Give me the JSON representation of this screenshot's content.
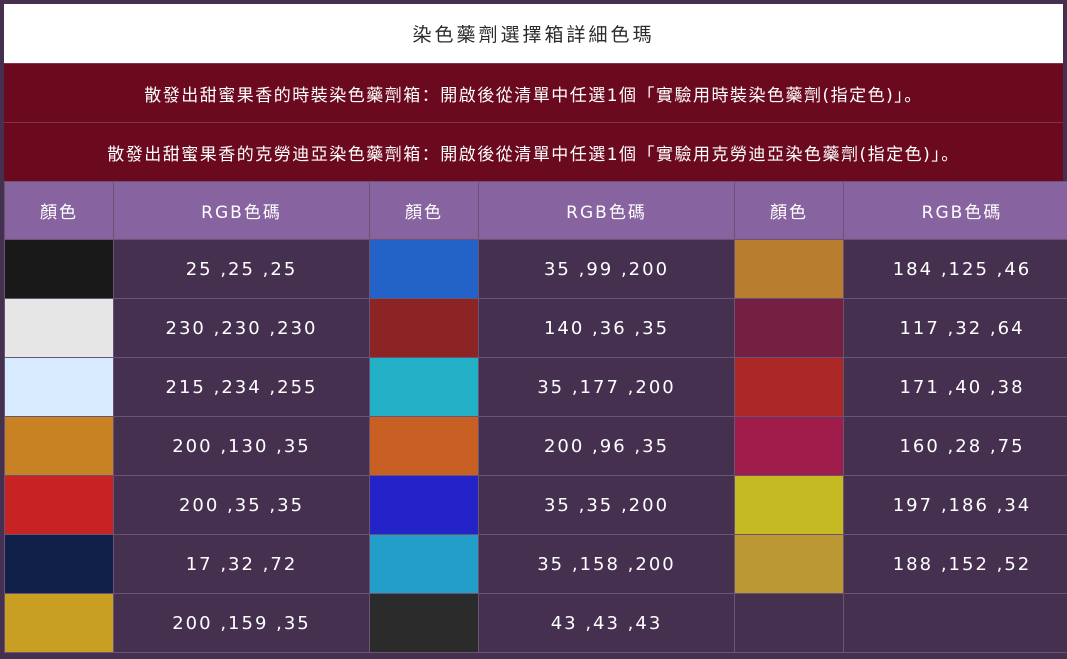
{
  "title": "染色藥劑選擇箱詳細色瑪",
  "descriptions": [
    "散發出甜蜜果香的時裝染色藥劑箱：開啟後從清單中任選1個「實驗用時裝染色藥劑(指定色)」。",
    "散發出甜蜜果香的克勞迪亞染色藥劑箱：開啟後從清單中任選1個「實驗用克勞迪亞染色藥劑(指定色)」。"
  ],
  "headers": {
    "color": "顏色",
    "rgb": "RGB色碼"
  },
  "rows": [
    [
      {
        "rgb": "25 ,25 ,25",
        "hex": "#191919"
      },
      {
        "rgb": "35 ,99 ,200",
        "hex": "#2363c8"
      },
      {
        "rgb": "184 ,125 ,46",
        "hex": "#b87d2e"
      }
    ],
    [
      {
        "rgb": "230 ,230 ,230",
        "hex": "#e6e6e6"
      },
      {
        "rgb": "140 ,36 ,35",
        "hex": "#8c2423"
      },
      {
        "rgb": "117 ,32 ,64",
        "hex": "#752040"
      }
    ],
    [
      {
        "rgb": "215 ,234 ,255",
        "hex": "#d7eaff"
      },
      {
        "rgb": "35 ,177 ,200",
        "hex": "#23b1c8"
      },
      {
        "rgb": "171 ,40 ,38",
        "hex": "#ab2826"
      }
    ],
    [
      {
        "rgb": "200 ,130 ,35",
        "hex": "#c88223"
      },
      {
        "rgb": "200 ,96 ,35",
        "hex": "#c86023"
      },
      {
        "rgb": "160 ,28 ,75",
        "hex": "#a01c4b"
      }
    ],
    [
      {
        "rgb": "200 ,35 ,35",
        "hex": "#c82323"
      },
      {
        "rgb": "35 ,35 ,200",
        "hex": "#2323c8"
      },
      {
        "rgb": "197 ,186 ,34",
        "hex": "#c5ba22"
      }
    ],
    [
      {
        "rgb": "17 ,32 ,72",
        "hex": "#112048"
      },
      {
        "rgb": "35 ,158 ,200",
        "hex": "#239ec8"
      },
      {
        "rgb": "188 ,152 ,52",
        "hex": "#bc9834"
      }
    ],
    [
      {
        "rgb": "200 ,159 ,35",
        "hex": "#c89f23"
      },
      {
        "rgb": "43 ,43 ,43",
        "hex": "#2b2b2b"
      },
      {
        "rgb": "",
        "hex": "#45304f"
      }
    ]
  ]
}
